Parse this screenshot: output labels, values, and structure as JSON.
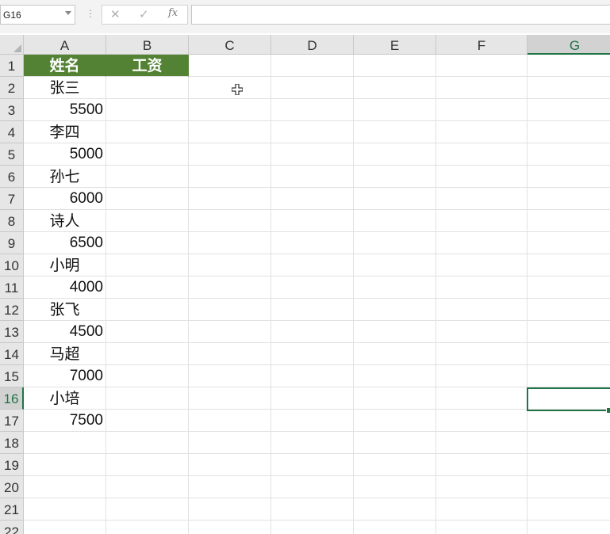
{
  "name_box": "G16",
  "formula_bar": {
    "value": "",
    "cancel_icon": "cancel-icon",
    "enter_icon": "check-icon",
    "fx_label": "fx"
  },
  "columns": [
    "A",
    "B",
    "C",
    "D",
    "E",
    "F",
    "G"
  ],
  "selected_column": "G",
  "selected_row": "16",
  "rows": [
    "1",
    "2",
    "3",
    "4",
    "5",
    "6",
    "7",
    "8",
    "9",
    "10",
    "11",
    "12",
    "13",
    "14",
    "15",
    "16",
    "17",
    "18",
    "19",
    "20",
    "21",
    "22"
  ],
  "headers": {
    "name": "姓名",
    "salary": "工资"
  },
  "column_a_values": [
    "张三",
    "5500",
    "李四",
    "5000",
    "孙七",
    "6000",
    "诗人",
    "6500",
    "小明",
    "4000",
    "张飞",
    "4500",
    "马超",
    "7000",
    "小培",
    "7500"
  ],
  "colors": {
    "header_fill": "#548235",
    "selection": "#217346"
  }
}
